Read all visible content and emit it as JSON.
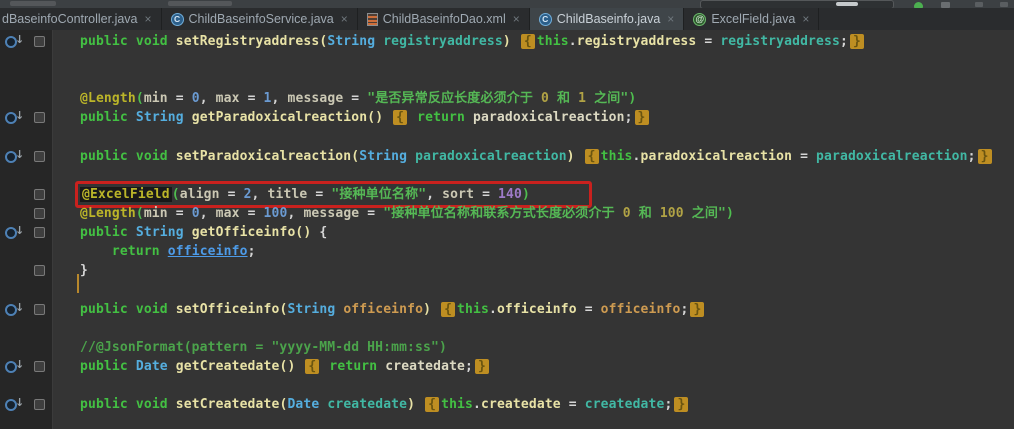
{
  "tab_bar": {
    "tabs": [
      {
        "label": "dBaseinfoController.java",
        "icon": "none",
        "active": false,
        "close_label": "×"
      },
      {
        "label": "ChildBaseinfoService.java",
        "icon": "java-class",
        "active": false,
        "close_label": "×"
      },
      {
        "label": "ChildBaseinfoDao.xml",
        "icon": "xml-file",
        "active": false,
        "close_label": "×"
      },
      {
        "label": "ChildBaseinfo.java",
        "icon": "java-class",
        "active": true,
        "close_label": "×"
      },
      {
        "label": "ExcelField.java",
        "icon": "annotation",
        "active": false,
        "close_label": "×"
      }
    ]
  },
  "colors": {
    "keyword_green": "#43C043",
    "string_green": "#55B855",
    "comment_green": "#4BA34B",
    "annotation_yellow": "#BBB529",
    "number_blue": "#6B9BD2",
    "number_purple": "#9E7BC8",
    "parameter_teal": "#41B8A4",
    "method_cream": "#E8E2A6",
    "type_cyan": "#55AEDF",
    "fold_highlight": "#BE8E22",
    "link_blue": "#4D9BE8",
    "orange_identifier": "#CE9B51",
    "red_annotation_box": "#C9211E",
    "run_icon_green": "#4CAF50"
  },
  "editor": {
    "lines": [
      {
        "gutter": [
          "impl",
          "square"
        ],
        "tokens": [
          [
            "kw",
            "public"
          ],
          [
            "op",
            " "
          ],
          [
            "kw",
            "void"
          ],
          [
            "op",
            " "
          ],
          [
            "mth",
            "setRegistryaddress"
          ],
          [
            "mth",
            "("
          ],
          [
            "typ",
            "String"
          ],
          [
            "op",
            " "
          ],
          [
            "par",
            "registryaddress"
          ],
          [
            "mth",
            ")"
          ],
          [
            "op",
            " "
          ],
          [
            "fold",
            "{"
          ],
          [
            "kw",
            "this"
          ],
          [
            "op",
            "."
          ],
          [
            "mth",
            "registryaddress"
          ],
          [
            "op",
            " = "
          ],
          [
            "par",
            "registryaddress"
          ],
          [
            "op",
            ";"
          ],
          [
            "fold",
            "}"
          ]
        ]
      },
      {
        "gutter": [],
        "tokens": []
      },
      {
        "gutter": [],
        "tokens": []
      },
      {
        "gutter": [],
        "tokens": [
          [
            "ann",
            "@Length"
          ],
          [
            "brk",
            "("
          ],
          [
            "att",
            "min"
          ],
          [
            "op",
            " = "
          ],
          [
            "num",
            "0"
          ],
          [
            "op",
            ", "
          ],
          [
            "att",
            "max"
          ],
          [
            "op",
            " = "
          ],
          [
            "num",
            "1"
          ],
          [
            "op",
            ", "
          ],
          [
            "att",
            "message"
          ],
          [
            "op",
            " = "
          ],
          [
            "str",
            "\"是否异常反应长度必须介于 "
          ],
          [
            "snum",
            "0"
          ],
          [
            "str",
            " 和 "
          ],
          [
            "snum",
            "1"
          ],
          [
            "str",
            " 之间\""
          ],
          [
            "brk",
            ")"
          ]
        ]
      },
      {
        "gutter": [
          "impl",
          "square"
        ],
        "tokens": [
          [
            "kw",
            "public"
          ],
          [
            "op",
            " "
          ],
          [
            "typ",
            "String"
          ],
          [
            "op",
            " "
          ],
          [
            "mth",
            "getParadoxicalreaction"
          ],
          [
            "mth",
            "()"
          ],
          [
            "op",
            " "
          ],
          [
            "fold",
            "{"
          ],
          [
            "op",
            " "
          ],
          [
            "kw",
            "return"
          ],
          [
            "op",
            " "
          ],
          [
            "id",
            "paradoxicalreaction"
          ],
          [
            "op",
            ";"
          ],
          [
            "fold",
            "}"
          ]
        ]
      },
      {
        "gutter": [],
        "tokens": []
      },
      {
        "gutter": [
          "impl",
          "square"
        ],
        "tokens": [
          [
            "kw",
            "public"
          ],
          [
            "op",
            " "
          ],
          [
            "kw",
            "void"
          ],
          [
            "op",
            " "
          ],
          [
            "mth",
            "setParadoxicalreaction"
          ],
          [
            "mth",
            "("
          ],
          [
            "typ",
            "String"
          ],
          [
            "op",
            " "
          ],
          [
            "par",
            "paradoxicalreaction"
          ],
          [
            "mth",
            ")"
          ],
          [
            "op",
            " "
          ],
          [
            "fold",
            "{"
          ],
          [
            "kw",
            "this"
          ],
          [
            "op",
            "."
          ],
          [
            "mth",
            "paradoxicalreaction"
          ],
          [
            "op",
            " = "
          ],
          [
            "par",
            "paradoxicalreaction"
          ],
          [
            "op",
            ";"
          ],
          [
            "fold",
            "}"
          ]
        ]
      },
      {
        "gutter": [],
        "tokens": []
      },
      {
        "gutter": [
          "square"
        ],
        "red_box": true,
        "tokens": [
          [
            "annhl",
            "@ExcelField"
          ],
          [
            "brk",
            "("
          ],
          [
            "att",
            "align"
          ],
          [
            "op",
            " = "
          ],
          [
            "num",
            "2"
          ],
          [
            "op",
            ", "
          ],
          [
            "att",
            "title"
          ],
          [
            "op",
            " = "
          ],
          [
            "str",
            "\"接种单位名称\""
          ],
          [
            "op",
            ", "
          ],
          [
            "att",
            "sort"
          ],
          [
            "op",
            " = "
          ],
          [
            "num2",
            "140"
          ],
          [
            "brk",
            ")"
          ]
        ]
      },
      {
        "gutter": [
          "square"
        ],
        "tokens": [
          [
            "ann",
            "@Length"
          ],
          [
            "brk",
            "("
          ],
          [
            "att",
            "min"
          ],
          [
            "op",
            " = "
          ],
          [
            "num",
            "0"
          ],
          [
            "op",
            ", "
          ],
          [
            "att",
            "max"
          ],
          [
            "op",
            " = "
          ],
          [
            "num",
            "100"
          ],
          [
            "op",
            ", "
          ],
          [
            "att",
            "message"
          ],
          [
            "op",
            " = "
          ],
          [
            "str",
            "\"接种单位名称和联系方式长度必须介于 "
          ],
          [
            "snum",
            "0"
          ],
          [
            "str",
            " 和 "
          ],
          [
            "snum",
            "100"
          ],
          [
            "str",
            " 之间\""
          ],
          [
            "brk",
            ")"
          ]
        ]
      },
      {
        "gutter": [
          "impl",
          "square"
        ],
        "tokens": [
          [
            "kw",
            "public"
          ],
          [
            "op",
            " "
          ],
          [
            "typ",
            "String"
          ],
          [
            "op",
            " "
          ],
          [
            "mth",
            "getOfficeinfo"
          ],
          [
            "mth",
            "()"
          ],
          [
            "op",
            " "
          ],
          [
            "op",
            "{"
          ]
        ]
      },
      {
        "gutter": [],
        "tokens": [
          [
            "op",
            "    "
          ],
          [
            "kw",
            "return"
          ],
          [
            "op",
            " "
          ],
          [
            "link",
            "officeinfo"
          ],
          [
            "op",
            ";"
          ]
        ]
      },
      {
        "gutter": [
          "square"
        ],
        "tokens": [
          [
            "op",
            "}"
          ]
        ]
      },
      {
        "gutter": [],
        "tokens": []
      },
      {
        "gutter": [
          "impl",
          "square"
        ],
        "tokens": [
          [
            "kw",
            "public"
          ],
          [
            "op",
            " "
          ],
          [
            "kw",
            "void"
          ],
          [
            "op",
            " "
          ],
          [
            "mth",
            "setOfficeinfo"
          ],
          [
            "mth",
            "("
          ],
          [
            "typ",
            "String"
          ],
          [
            "op",
            " "
          ],
          [
            "fldo",
            "officeinfo"
          ],
          [
            "mth",
            ")"
          ],
          [
            "op",
            " "
          ],
          [
            "fold",
            "{"
          ],
          [
            "kw",
            "this"
          ],
          [
            "op",
            "."
          ],
          [
            "mth",
            "officeinfo"
          ],
          [
            "op",
            " = "
          ],
          [
            "fldo",
            "officeinfo"
          ],
          [
            "op",
            ";"
          ],
          [
            "fold",
            "}"
          ]
        ]
      },
      {
        "gutter": [],
        "tokens": []
      },
      {
        "gutter": [],
        "tokens": [
          [
            "cmt",
            "//@JsonFormat(pattern = \"yyyy-MM-dd HH:mm:ss\")"
          ]
        ]
      },
      {
        "gutter": [
          "impl",
          "square"
        ],
        "tokens": [
          [
            "kw",
            "public"
          ],
          [
            "op",
            " "
          ],
          [
            "typ",
            "Date"
          ],
          [
            "op",
            " "
          ],
          [
            "mth",
            "getCreatedate"
          ],
          [
            "mth",
            "()"
          ],
          [
            "op",
            " "
          ],
          [
            "fold",
            "{"
          ],
          [
            "op",
            " "
          ],
          [
            "kw",
            "return"
          ],
          [
            "op",
            " "
          ],
          [
            "id",
            "createdate"
          ],
          [
            "op",
            ";"
          ],
          [
            "fold",
            "}"
          ]
        ]
      },
      {
        "gutter": [],
        "tokens": []
      },
      {
        "gutter": [
          "impl",
          "square"
        ],
        "tokens": [
          [
            "kw",
            "public"
          ],
          [
            "op",
            " "
          ],
          [
            "kw",
            "void"
          ],
          [
            "op",
            " "
          ],
          [
            "mth",
            "setCreatedate"
          ],
          [
            "mth",
            "("
          ],
          [
            "typ",
            "Date"
          ],
          [
            "op",
            " "
          ],
          [
            "par",
            "createdate"
          ],
          [
            "mth",
            ")"
          ],
          [
            "op",
            " "
          ],
          [
            "fold",
            "{"
          ],
          [
            "kw",
            "this"
          ],
          [
            "op",
            "."
          ],
          [
            "mth",
            "createdate"
          ],
          [
            "op",
            " = "
          ],
          [
            "par",
            "createdate"
          ],
          [
            "op",
            ";"
          ],
          [
            "fold",
            "}"
          ]
        ]
      }
    ]
  }
}
